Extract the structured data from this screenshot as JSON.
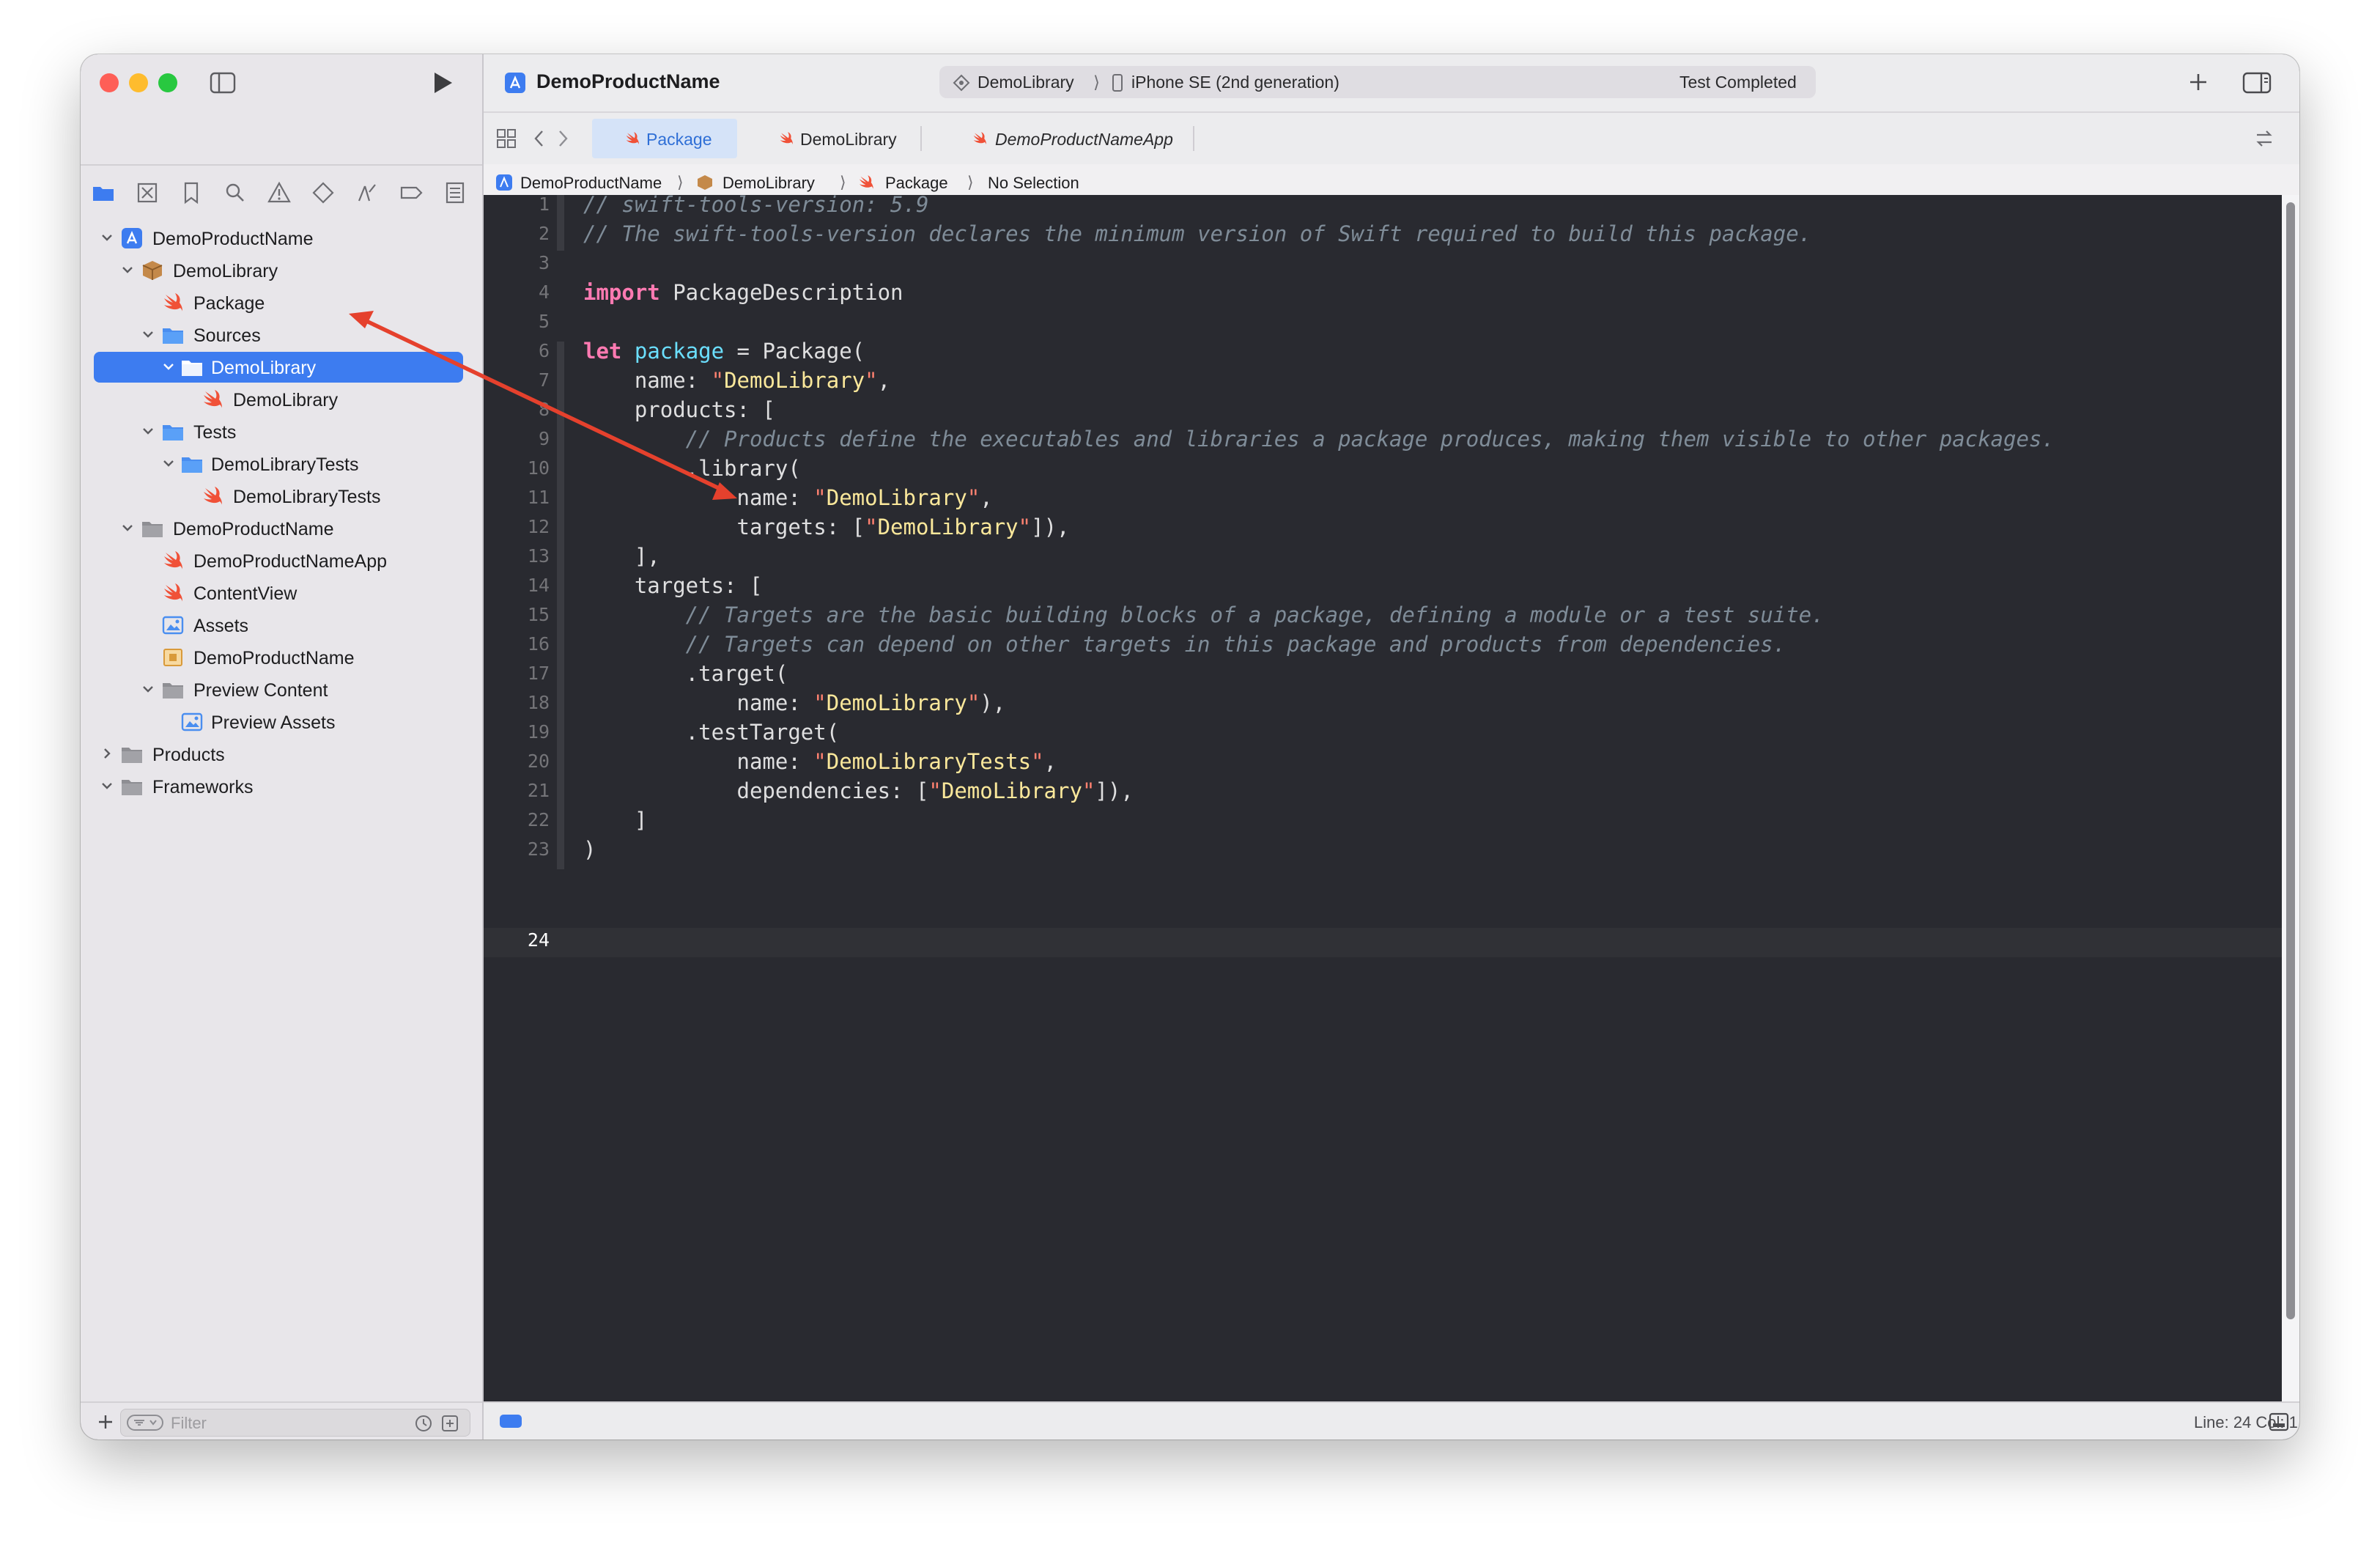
{
  "toolbar": {
    "project_title": "DemoProductName",
    "scheme": "DemoLibrary",
    "destination": "iPhone SE (2nd generation)",
    "activity_status": "Test Completed"
  },
  "navigator": {
    "tree": [
      {
        "label": "DemoProductName",
        "icon": "xcode-project-icon",
        "expanded": true
      },
      {
        "label": "DemoLibrary",
        "icon": "package-icon",
        "expanded": true
      },
      {
        "label": "Package",
        "icon": "swift-file-icon"
      },
      {
        "label": "Sources",
        "icon": "folder-icon",
        "expanded": true
      },
      {
        "label": "DemoLibrary",
        "icon": "folder-icon",
        "expanded": true,
        "selected": true
      },
      {
        "label": "DemoLibrary",
        "icon": "swift-file-icon"
      },
      {
        "label": "Tests",
        "icon": "folder-icon",
        "expanded": true
      },
      {
        "label": "DemoLibraryTests",
        "icon": "folder-icon",
        "expanded": true
      },
      {
        "label": "DemoLibraryTests",
        "icon": "swift-file-icon"
      },
      {
        "label": "DemoProductName",
        "icon": "group-folder-icon",
        "expanded": true
      },
      {
        "label": "DemoProductNameApp",
        "icon": "swift-file-icon"
      },
      {
        "label": "ContentView",
        "icon": "swift-file-icon"
      },
      {
        "label": "Assets",
        "icon": "asset-catalog-icon"
      },
      {
        "label": "DemoProductName",
        "icon": "entitlements-icon"
      },
      {
        "label": "Preview Content",
        "icon": "group-folder-icon",
        "expanded": true
      },
      {
        "label": "Preview Assets",
        "icon": "asset-catalog-icon"
      },
      {
        "label": "Products",
        "icon": "group-folder-icon",
        "expanded": false
      },
      {
        "label": "Frameworks",
        "icon": "group-folder-icon",
        "expanded": true
      }
    ],
    "filter_placeholder": "Filter"
  },
  "tabs": [
    {
      "label": "Package",
      "icon": "swift-file-icon",
      "active": true
    },
    {
      "label": "DemoLibrary",
      "icon": "swift-file-icon"
    },
    {
      "label": "DemoProductNameApp",
      "icon": "swift-file-icon",
      "italic": true
    }
  ],
  "breadcrumb": [
    "DemoProductName",
    "DemoLibrary",
    "Package",
    "No Selection"
  ],
  "editor": {
    "current_line": 24,
    "lines": [
      "// swift-tools-version: 5.9",
      "// The swift-tools-version declares the minimum version of Swift required to build this package.",
      "",
      "import PackageDescription",
      "",
      "let package = Package(",
      "    name: \"DemoLibrary\",",
      "    products: [",
      "        // Products define the executables and libraries a package produces, making them visible to other packages.",
      "        .library(",
      "            name: \"DemoLibrary\",",
      "            targets: [\"DemoLibrary\"]),",
      "    ],",
      "    targets: [",
      "        // Targets are the basic building blocks of a package, defining a module or a test suite.",
      "        // Targets can depend on other targets in this package and products from dependencies.",
      "        .target(",
      "            name: \"DemoLibrary\"),",
      "        .testTarget(",
      "            name: \"DemoLibraryTests\",",
      "            dependencies: [\"DemoLibrary\"]),",
      "    ]",
      ")",
      ""
    ]
  },
  "statusbar": {
    "position": "Line: 24  Col: 1"
  },
  "colors": {
    "selection": "#3d7cf0",
    "annotation_arrow": "#e5412d",
    "editor_background": "#292a30"
  }
}
